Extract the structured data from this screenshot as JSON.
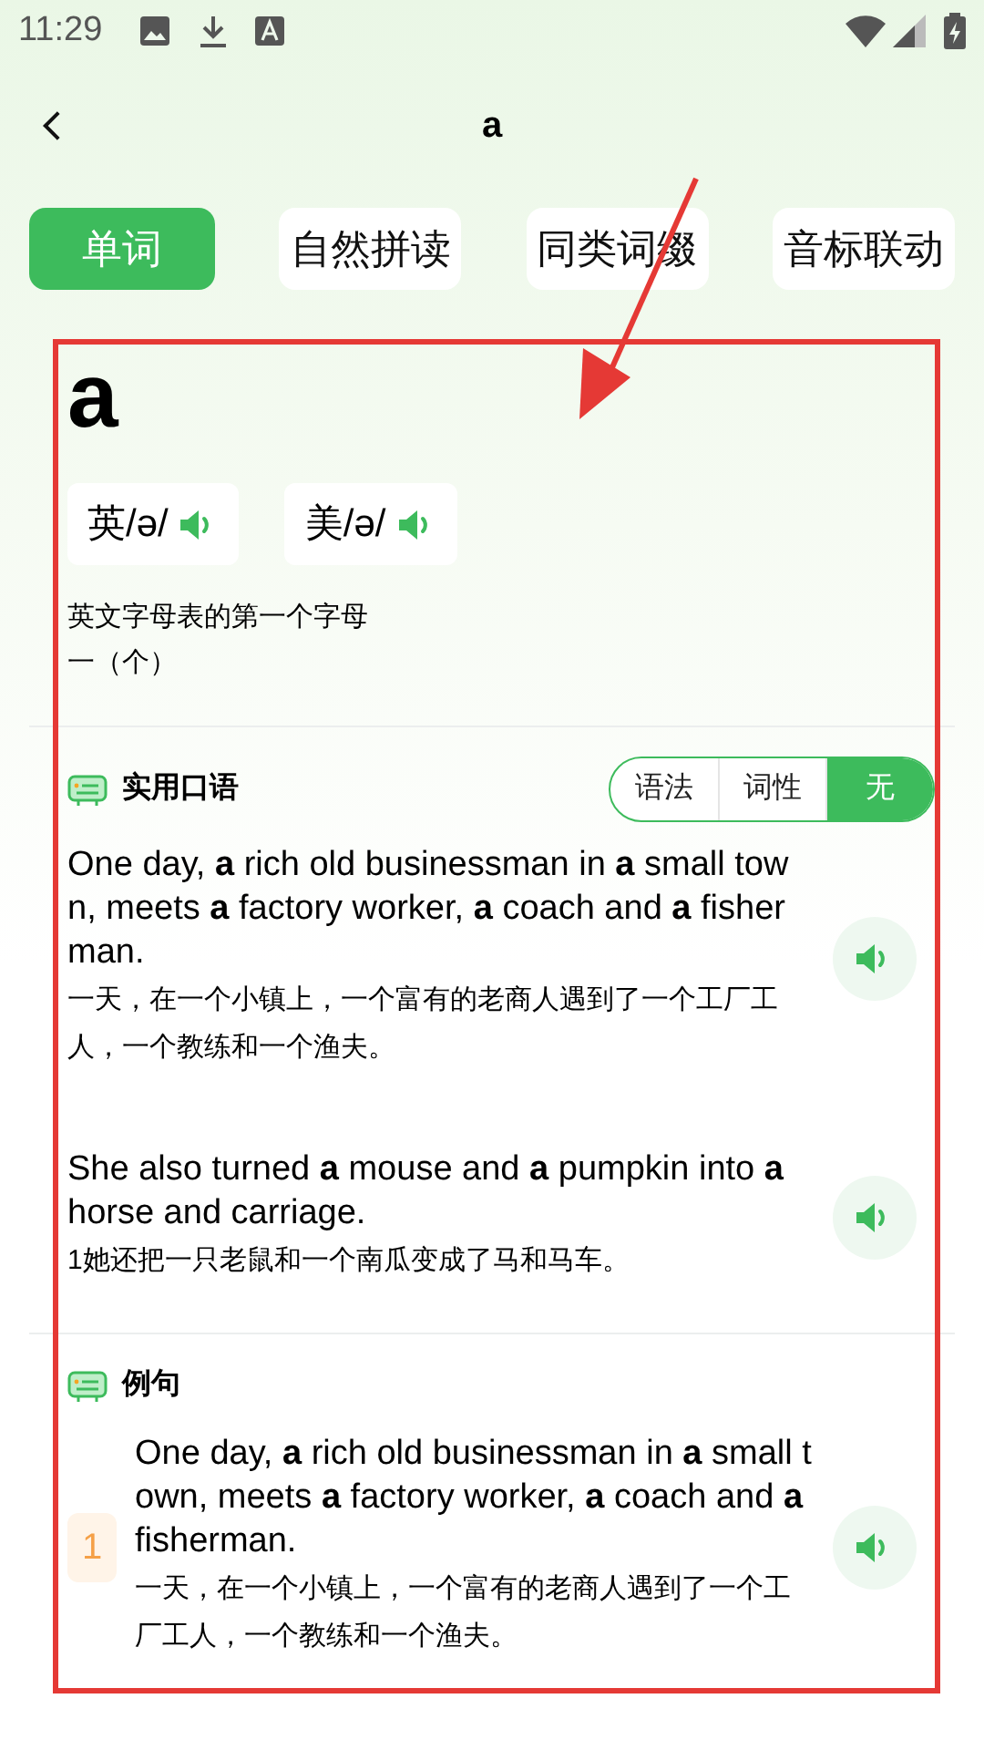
{
  "status_bar": {
    "time": "11:29"
  },
  "header": {
    "title": "a"
  },
  "tabs": [
    {
      "label": "单词",
      "selected": true
    },
    {
      "label": "自然拼读",
      "selected": false
    },
    {
      "label": "同类词缀",
      "selected": false
    },
    {
      "label": "音标联动",
      "selected": false
    }
  ],
  "word": {
    "headword": "a",
    "pronunciations": [
      {
        "label": "英/ə/"
      },
      {
        "label": "美/ə/"
      }
    ],
    "definitions": [
      "英文字母表的第一个字母",
      "一（个）"
    ]
  },
  "spoken": {
    "title": "实用口语",
    "filters": [
      {
        "label": "语法",
        "selected": false
      },
      {
        "label": "词性",
        "selected": false
      },
      {
        "label": "无",
        "selected": true
      }
    ],
    "sentences": [
      {
        "english": "One day, **a** rich old businessman in **a** small town, meets **a** factory worker, **a** coach and **a** fisherman.",
        "chinese": "一天，在一个小镇上，一个富有的老商人遇到了一个工厂工人，一个教练和一个渔夫。"
      },
      {
        "english": "She also turned **a** mouse and **a** pumpkin into **a** horse and carriage.",
        "chinese": "1她还把一只老鼠和一个南瓜变成了马和马车。"
      }
    ]
  },
  "examples": {
    "title": "例句",
    "sentences": [
      {
        "number": "1",
        "english": "One day, **a** rich old businessman in **a** small town, meets **a** factory worker, **a** coach and **a** fisherman.",
        "chinese": "一天，在一个小镇上，一个富有的老商人遇到了一个工厂工人，一个教练和一个渔夫。"
      }
    ]
  }
}
